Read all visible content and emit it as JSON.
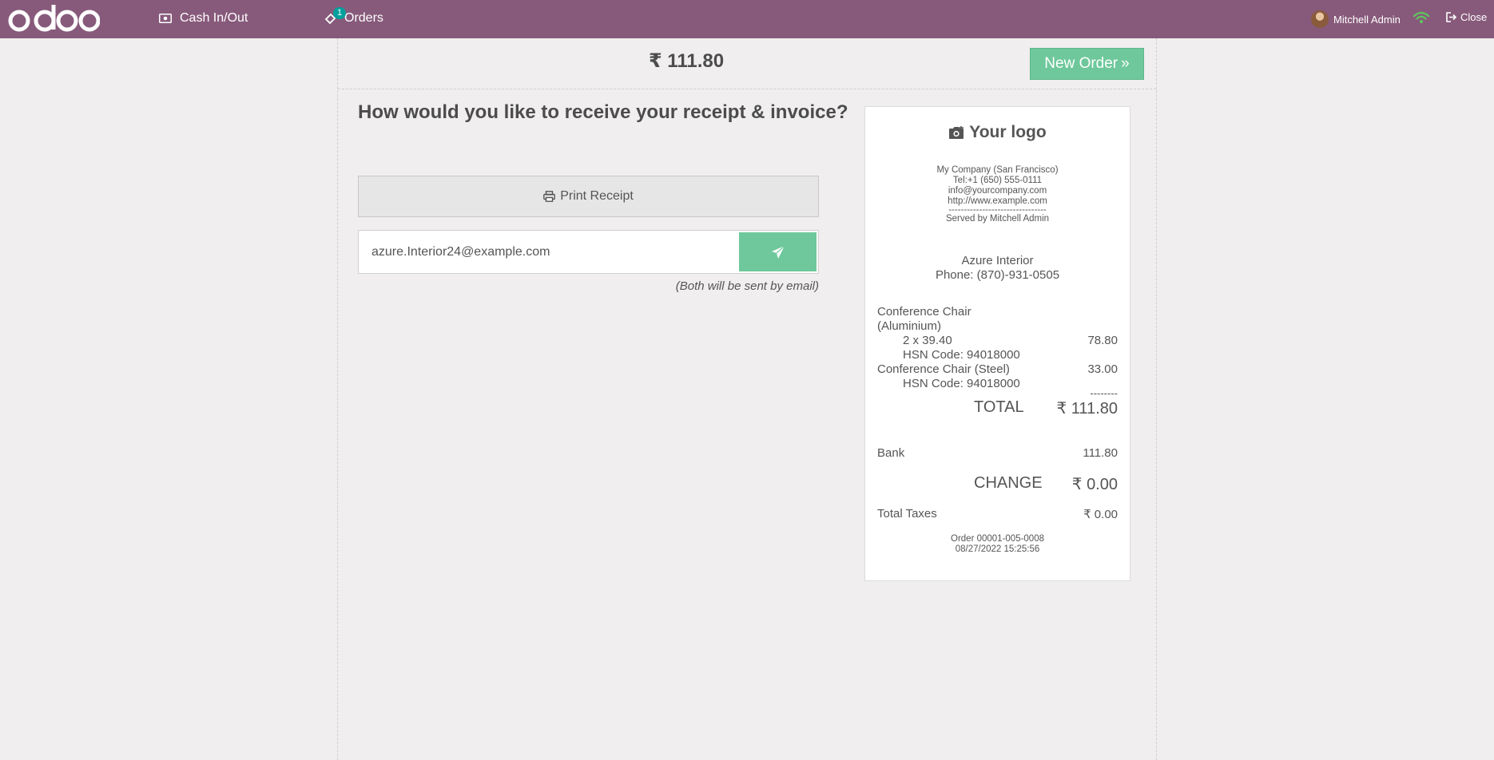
{
  "header": {
    "cash_label": "Cash In/Out",
    "orders_label": "Orders",
    "orders_badge": "1",
    "user_name": "Mitchell Admin",
    "close_label": "Close",
    "accent": "#875a7b"
  },
  "screen": {
    "total": "₹ 111.80",
    "new_order_label": "New Order",
    "question": "How would you like to receive your receipt & invoice?",
    "print_label": "Print Receipt",
    "email_value": "azure.Interior24@example.com",
    "email_note": "(Both will be sent by email)"
  },
  "receipt": {
    "logo_text": "Your logo",
    "company": "My Company (San Francisco)",
    "tel": "Tel:+1 (650) 555-0111",
    "email": "info@yourcompany.com",
    "website": "http://www.example.com",
    "separator": "--------------------------------",
    "served_by": "Served by Mitchell Admin",
    "customer": "Azure Interior",
    "phone": "Phone: (870)-931-0505",
    "lines": [
      {
        "name1": "Conference Chair",
        "name2": "(Aluminium)",
        "qty": "2 x 39.40",
        "price": "78.80",
        "hsn": "HSN Code: 94018000"
      },
      {
        "name1": "Conference Chair (Steel)",
        "price": "33.00",
        "hsn": "HSN Code: 94018000"
      }
    ],
    "dashes": "--------",
    "total_label": "TOTAL",
    "total_value": "₹ 111.80",
    "payment_label": "Bank",
    "payment_value": "111.80",
    "change_label": "CHANGE",
    "change_value": "₹ 0.00",
    "taxes_label": "Total Taxes",
    "taxes_value": "₹ 0.00",
    "order_ref": "Order 00001-005-0008",
    "order_date": "08/27/2022 15:25:56"
  }
}
